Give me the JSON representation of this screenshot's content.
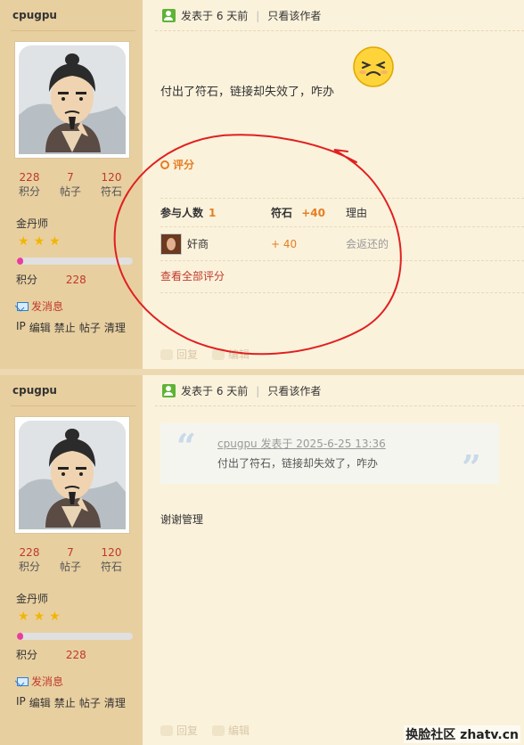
{
  "posts": [
    {
      "username": "cpugpu",
      "stats": [
        {
          "value": "228",
          "label": "积分"
        },
        {
          "value": "7",
          "label": "帖子"
        },
        {
          "value": "120",
          "label": "符石"
        }
      ],
      "rank": "金丹师",
      "stars_count": 3,
      "progress_percent": 5,
      "points_label": "积分",
      "points_value": "228",
      "send_message": "发消息",
      "admin_links": [
        "IP",
        "编辑",
        "禁止",
        "帖子",
        "清理"
      ],
      "posted": "发表于 6 天前",
      "only_author": "只看该作者",
      "content": "付出了符石，链接却失效了，咋办",
      "rating": {
        "title": "评分",
        "participants_label": "参与人数",
        "participants_count": "1",
        "stone_label": "符石",
        "stone_total": "+40",
        "reason_label": "理由",
        "raters": [
          {
            "name": "奸商",
            "score": "+ 40",
            "reason": "会返还的"
          }
        ],
        "view_all": "查看全部评分"
      },
      "reply_label": "回复",
      "edit_label": "编辑"
    },
    {
      "username": "cpugpu",
      "stats": [
        {
          "value": "228",
          "label": "积分"
        },
        {
          "value": "7",
          "label": "帖子"
        },
        {
          "value": "120",
          "label": "符石"
        }
      ],
      "rank": "金丹师",
      "stars_count": 3,
      "progress_percent": 5,
      "points_label": "积分",
      "points_value": "228",
      "send_message": "发消息",
      "admin_links": [
        "IP",
        "编辑",
        "禁止",
        "帖子",
        "清理"
      ],
      "posted": "发表于 6 天前",
      "only_author": "只看该作者",
      "quote": {
        "meta": "cpugpu 发表于 2025-6-25 13:36",
        "text": "付出了符石，链接却失效了，咋办"
      },
      "content": "谢谢管理",
      "reply_label": "回复",
      "edit_label": "编辑"
    }
  ],
  "watermark": "换脸社区 zhatv.cn",
  "colors": {
    "sidebar_bg": "#e8cfa0",
    "main_bg": "#fbf2dc",
    "accent_red": "#c0392b",
    "accent_orange": "#e67e22",
    "annotation_circle": "#e02020"
  }
}
